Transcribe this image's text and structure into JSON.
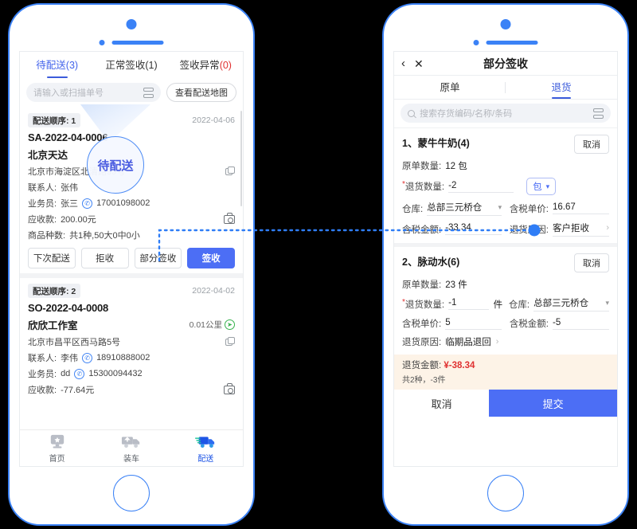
{
  "left_phone": {
    "tabs": [
      {
        "label": "待配送",
        "count": "(3)",
        "active": true,
        "count_red": false
      },
      {
        "label": "正常签收",
        "count": "(1)",
        "active": false,
        "count_red": false
      },
      {
        "label": "签收异常",
        "count": "(0)",
        "active": false,
        "count_red": true
      }
    ],
    "search_placeholder": "请输入或扫描单号",
    "map_button": "查看配送地图",
    "magnifier_text": "待配送",
    "orders": [
      {
        "seq_label": "配送顺序:",
        "seq_value": "1",
        "date": "2022-04-06",
        "order_no": "SA-2022-04-0006",
        "customer": "北京天达",
        "distance": "",
        "address": "北京市海淀区北清路99号",
        "contact_label": "联系人:",
        "contact_name": "张伟",
        "contact_phone": "",
        "sales_label": "业务员:",
        "sales_name": "张三",
        "sales_phone": "17001098002",
        "receivable_label": "应收款:",
        "receivable_value": "200.00元",
        "goods_label": "商品种数:",
        "goods_value": "共1种,50大0中0小",
        "buttons": [
          "下次配送",
          "拒收",
          "部分签收",
          "签收"
        ]
      },
      {
        "seq_label": "配送顺序:",
        "seq_value": "2",
        "date": "2022-04-02",
        "order_no": "SO-2022-04-0008",
        "customer": "欣欣工作室",
        "distance": "0.01公里",
        "address": "北京市昌平区西马路5号",
        "contact_label": "联系人:",
        "contact_name": "李伟",
        "contact_phone": "18910888002",
        "sales_label": "业务员:",
        "sales_name": "dd",
        "sales_phone": "15300094432",
        "receivable_label": "应收款:",
        "receivable_value": "-77.64元"
      }
    ],
    "bottom_nav": [
      {
        "label": "首页",
        "icon": "home-star-icon",
        "active": false
      },
      {
        "label": "装车",
        "icon": "loading-truck-icon",
        "active": false
      },
      {
        "label": "配送",
        "icon": "delivery-truck-icon",
        "active": true
      }
    ]
  },
  "right_phone": {
    "header": {
      "back_icon": "‹",
      "close_icon": "✕",
      "title": "部分签收"
    },
    "tabs": [
      {
        "label": "原单",
        "active": false
      },
      {
        "label": "退货",
        "active": true
      }
    ],
    "search_placeholder": "搜索存货编码/名称/条码",
    "items": [
      {
        "index_name": "1、蒙牛牛奶(4)",
        "cancel_label": "取消",
        "orig_qty_label": "原单数量:",
        "orig_qty_value": "12 包",
        "return_qty_label": "退货数量:",
        "return_qty_value": "-2",
        "unit_value": "包",
        "warehouse_label": "仓库:",
        "warehouse_value": "总部三元桥仓",
        "tax_price_label": "含税单价:",
        "tax_price_value": "16.67",
        "tax_amount_label": "含税金额:",
        "tax_amount_value": "-33.34",
        "reason_label": "退货原因:",
        "reason_value": "客户拒收"
      },
      {
        "index_name": "2、脉动水(6)",
        "cancel_label": "取消",
        "orig_qty_label": "原单数量:",
        "orig_qty_value": "23 件",
        "return_qty_label": "退货数量:",
        "return_qty_value": "-1",
        "unit_value": "件",
        "warehouse_label": "仓库:",
        "warehouse_value": "总部三元桥仓",
        "tax_price_label": "含税单价:",
        "tax_price_value": "5",
        "tax_amount_label": "含税金额:",
        "tax_amount_value": "-5",
        "reason_label": "退货原因:",
        "reason_value": "临期品退回"
      }
    ],
    "summary": {
      "label": "退货金额:",
      "amount": "¥-38.34",
      "detail": "共2种，-3件"
    },
    "actions": {
      "cancel": "取消",
      "submit": "提交"
    }
  },
  "colors": {
    "accent_blue": "#4c6ef5",
    "frame_blue": "#3b82f6",
    "tab_active": "#3b5bdb",
    "danger_red": "#e03131",
    "summary_bg": "#fdf3e7",
    "background": "#000000"
  }
}
